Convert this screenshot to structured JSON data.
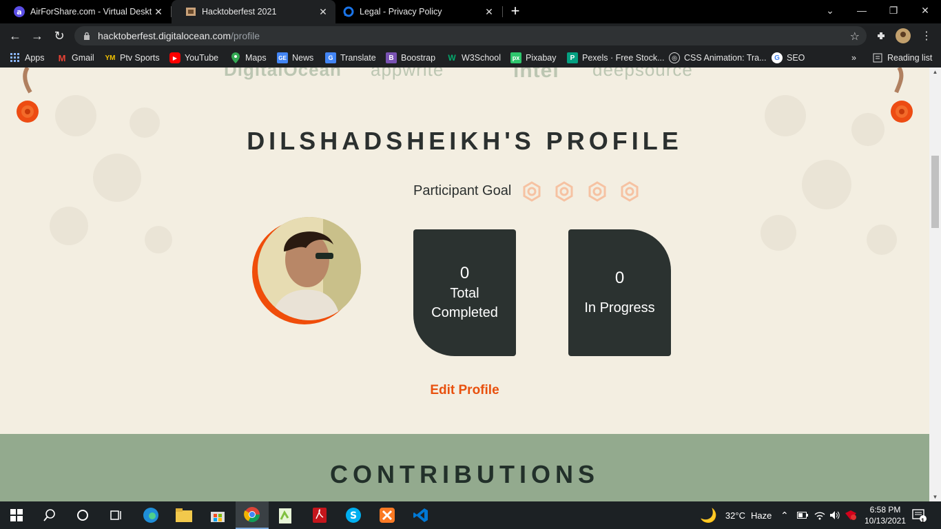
{
  "browser": {
    "tabs": [
      {
        "title": "AirForShare.com - Virtual Deskto",
        "active": false
      },
      {
        "title": "Hacktoberfest 2021",
        "active": true
      },
      {
        "title": "Legal - Privacy Policy",
        "active": false
      }
    ],
    "url_host": "hacktoberfest.digitalocean.com",
    "url_path": "/profile",
    "bookmarks": [
      "Apps",
      "Gmail",
      "Ptv Sports",
      "YouTube",
      "Maps",
      "News",
      "Translate",
      "Boostrap",
      "W3School",
      "Pixabay",
      "Pexels · Free Stock...",
      "CSS Animation: Tra...",
      "SEO"
    ],
    "reading_list": "Reading list",
    "overflow": "»"
  },
  "page": {
    "sponsors": [
      "DigitalOcean",
      "appwrite",
      "intel",
      "deepsource"
    ],
    "profile_title": "DILSHADSHEIKH'S PROFILE",
    "goal_label": "Participant Goal",
    "goal_completed": 0,
    "goal_total": 4,
    "stats": {
      "completed_value": "0",
      "completed_label_1": "Total",
      "completed_label_2": "Completed",
      "progress_value": "0",
      "progress_label": "In Progress"
    },
    "edit_profile": "Edit Profile",
    "contributions_title": "CONTRIBUTIONS"
  },
  "taskbar": {
    "weather_temp": "32°C",
    "weather_desc": "Haze",
    "time": "6:58 PM",
    "date": "10/13/2021",
    "notifications": "1"
  },
  "colors": {
    "accent": "#e8500d",
    "card": "#2b3230",
    "cream": "#f3eee1",
    "green": "#93aa8e"
  }
}
